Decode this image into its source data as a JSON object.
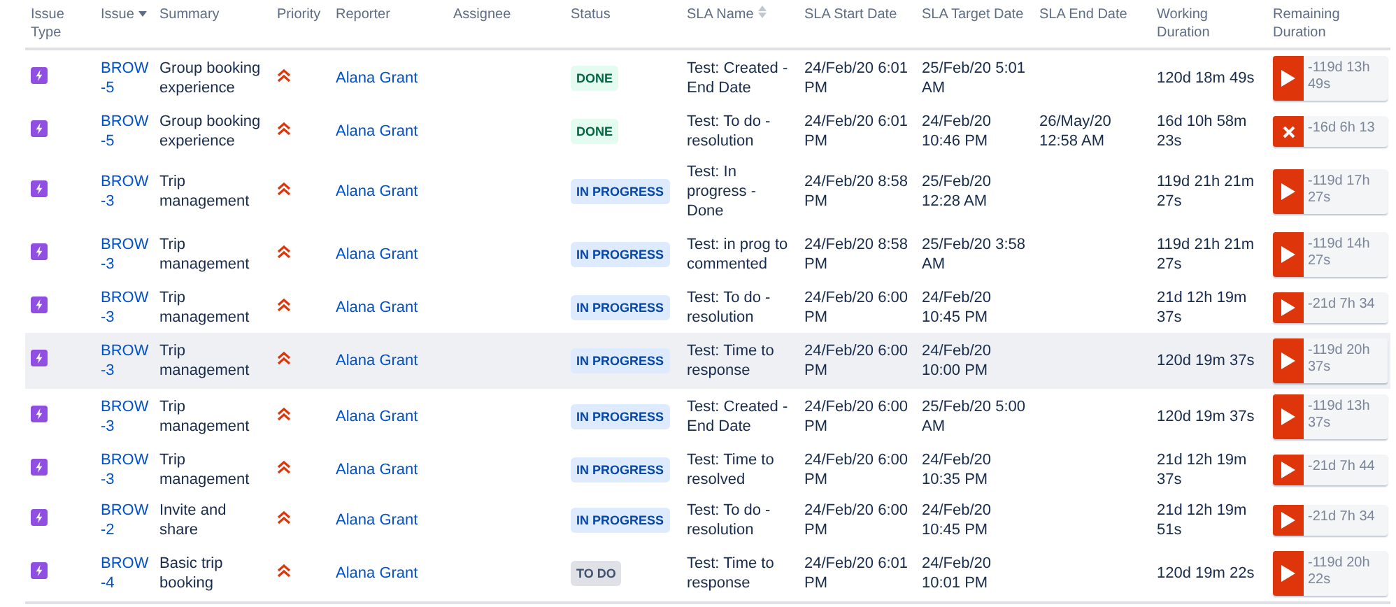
{
  "table": {
    "columns": [
      {
        "label": "Issue Type",
        "sorted_descending": false,
        "sortable": false
      },
      {
        "label": "Issue",
        "sorted_descending": true,
        "sortable": false
      },
      {
        "label": "Summary",
        "sorted_descending": false,
        "sortable": false
      },
      {
        "label": "Priority",
        "sorted_descending": false,
        "sortable": false
      },
      {
        "label": "Reporter",
        "sorted_descending": false,
        "sortable": false
      },
      {
        "label": "Assignee",
        "sorted_descending": false,
        "sortable": false
      },
      {
        "label": "Status",
        "sorted_descending": false,
        "sortable": false
      },
      {
        "label": "SLA Name",
        "sorted_descending": false,
        "sortable": true
      },
      {
        "label": "SLA Start Date",
        "sorted_descending": false,
        "sortable": false
      },
      {
        "label": "SLA Target Date",
        "sorted_descending": false,
        "sortable": false
      },
      {
        "label": "SLA End Date",
        "sorted_descending": false,
        "sortable": false
      },
      {
        "label": "Working Duration",
        "sorted_descending": false,
        "sortable": false
      },
      {
        "label": "Remaining Duration",
        "sorted_descending": false,
        "sortable": false
      }
    ],
    "rows": [
      {
        "highlighted": false,
        "issue": "BROW -5",
        "summary": "Group booking experience",
        "reporter": "Alana Grant",
        "status": {
          "label": "DONE",
          "kind": "done"
        },
        "sla_name": "Test: Created - End Date",
        "start": "24/Feb/20 6:01 PM",
        "target": "25/Feb/20 5:01 AM",
        "end": "",
        "working": "120d 18m 49s",
        "remaining": {
          "kind": "running",
          "text": "-119d 13h 49s"
        }
      },
      {
        "highlighted": false,
        "issue": "BROW -5",
        "summary": "Group booking experience",
        "reporter": "Alana Grant",
        "status": {
          "label": "DONE",
          "kind": "done"
        },
        "sla_name": "Test: To do - resolution",
        "start": "24/Feb/20 6:01 PM",
        "target": "24/Feb/20 10:46 PM",
        "end": "26/May/20 12:58 AM",
        "working": "16d 10h 58m 23s",
        "remaining": {
          "kind": "breached",
          "text": "-16d 6h 13"
        }
      },
      {
        "highlighted": false,
        "issue": "BROW -3",
        "summary": "Trip management",
        "reporter": "Alana Grant",
        "status": {
          "label": "IN PROGRESS",
          "kind": "inprogress"
        },
        "sla_name": "Test: In progress - Done",
        "start": "24/Feb/20 8:58 PM",
        "target": "25/Feb/20 12:28 AM",
        "end": "",
        "working": "119d 21h 21m 27s",
        "remaining": {
          "kind": "running",
          "text": "-119d 17h 27s"
        }
      },
      {
        "highlighted": false,
        "issue": "BROW -3",
        "summary": "Trip management",
        "reporter": "Alana Grant",
        "status": {
          "label": "IN PROGRESS",
          "kind": "inprogress"
        },
        "sla_name": "Test: in prog to commented",
        "start": "24/Feb/20 8:58 PM",
        "target": "25/Feb/20 3:58 AM",
        "end": "",
        "working": "119d 21h 21m 27s",
        "remaining": {
          "kind": "running",
          "text": "-119d 14h 27s"
        }
      },
      {
        "highlighted": false,
        "issue": "BROW -3",
        "summary": "Trip management",
        "reporter": "Alana Grant",
        "status": {
          "label": "IN PROGRESS",
          "kind": "inprogress"
        },
        "sla_name": "Test: To do - resolution",
        "start": "24/Feb/20 6:00 PM",
        "target": "24/Feb/20 10:45 PM",
        "end": "",
        "working": "21d 12h 19m 37s",
        "remaining": {
          "kind": "running",
          "text": "-21d 7h 34"
        }
      },
      {
        "highlighted": true,
        "issue": "BROW -3",
        "summary": "Trip management",
        "reporter": "Alana Grant",
        "status": {
          "label": "IN PROGRESS",
          "kind": "inprogress"
        },
        "sla_name": "Test: Time to response",
        "start": "24/Feb/20 6:00 PM",
        "target": "24/Feb/20 10:00 PM",
        "end": "",
        "working": "120d 19m 37s",
        "remaining": {
          "kind": "running",
          "text": "-119d 20h 37s"
        }
      },
      {
        "highlighted": false,
        "issue": "BROW -3",
        "summary": "Trip management",
        "reporter": "Alana Grant",
        "status": {
          "label": "IN PROGRESS",
          "kind": "inprogress"
        },
        "sla_name": "Test: Created - End Date",
        "start": "24/Feb/20 6:00 PM",
        "target": "25/Feb/20 5:00 AM",
        "end": "",
        "working": "120d 19m 37s",
        "remaining": {
          "kind": "running",
          "text": "-119d 13h 37s"
        }
      },
      {
        "highlighted": false,
        "issue": "BROW -3",
        "summary": "Trip management",
        "reporter": "Alana Grant",
        "status": {
          "label": "IN PROGRESS",
          "kind": "inprogress"
        },
        "sla_name": "Test: Time to resolved",
        "start": "24/Feb/20 6:00 PM",
        "target": "24/Feb/20 10:35 PM",
        "end": "",
        "working": "21d 12h 19m 37s",
        "remaining": {
          "kind": "running",
          "text": "-21d 7h 44"
        }
      },
      {
        "highlighted": false,
        "issue": "BROW -2",
        "summary": "Invite and share",
        "reporter": "Alana Grant",
        "status": {
          "label": "IN PROGRESS",
          "kind": "inprogress"
        },
        "sla_name": "Test: To do - resolution",
        "start": "24/Feb/20 6:00 PM",
        "target": "24/Feb/20 10:45 PM",
        "end": "",
        "working": "21d 12h 19m 51s",
        "remaining": {
          "kind": "running",
          "text": "-21d 7h 34"
        }
      },
      {
        "highlighted": false,
        "issue": "BROW -4",
        "summary": "Basic trip booking",
        "reporter": "Alana Grant",
        "status": {
          "label": "TO DO",
          "kind": "todo"
        },
        "sla_name": "Test: Time to response",
        "start": "24/Feb/20 6:01 PM",
        "target": "24/Feb/20 10:01 PM",
        "end": "",
        "working": "120d 19m 22s",
        "remaining": {
          "kind": "running",
          "text": "-119d 20h 22s"
        }
      }
    ]
  }
}
